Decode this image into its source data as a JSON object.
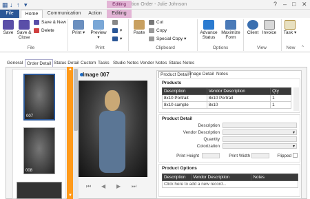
{
  "window": {
    "title": "Production Order - Julie Johnson",
    "context_label_1": "Editing",
    "context_label_2": "Editing"
  },
  "ribbon_tabs": [
    "File",
    "Home",
    "Communication",
    "Action",
    "Editing"
  ],
  "ribbon": {
    "file_group": {
      "label": "File",
      "save": "Save",
      "save_close": "Save & Close",
      "save_new": "Save & New",
      "delete": "Delete"
    },
    "print_group": {
      "label": "Print",
      "print": "Print",
      "preview": "Preview"
    },
    "clipboard_group": {
      "label": "Clipboard",
      "paste": "Paste",
      "cut": "Cut",
      "copy": "Copy",
      "special_copy": "Special Copy"
    },
    "options_group": {
      "label": "Options",
      "advance_status": "Advance Status",
      "maximize_form": "Maximize Form"
    },
    "view_group": {
      "label": "View",
      "client": "Client",
      "invoice": "Invoice"
    },
    "new_group": {
      "label": "New",
      "task": "Task"
    }
  },
  "page_tabs": [
    "General",
    "Order Detail",
    "Status Detail",
    "Custom",
    "Tasks",
    "Studio Notes",
    "Vendor Notes",
    "Status Notes"
  ],
  "thumbnails": [
    {
      "label": "007"
    },
    {
      "label": "008"
    }
  ],
  "image": {
    "title": "Image 007"
  },
  "right_tabs": [
    "Product Detail",
    "Image Detail",
    "Notes"
  ],
  "products": {
    "title": "Products",
    "columns": [
      "Description",
      "Vendor Description",
      "Qty"
    ],
    "rows": [
      [
        "8x10 Portrait",
        "8x10 Portrait",
        "1"
      ],
      [
        "8x10 sample",
        "8x10",
        "1"
      ]
    ]
  },
  "product_detail": {
    "title": "Product Detail",
    "fields": [
      "Description",
      "Vendor Description",
      "Quantity",
      "Colorization"
    ],
    "print_height": "Print Height",
    "print_width": "Print Width",
    "flipped": "Flipped"
  },
  "product_options": {
    "title": "Product Options",
    "columns": [
      "Description",
      "Vendor Description",
      "Notes"
    ],
    "add_row": "Click here to add a new record..."
  }
}
